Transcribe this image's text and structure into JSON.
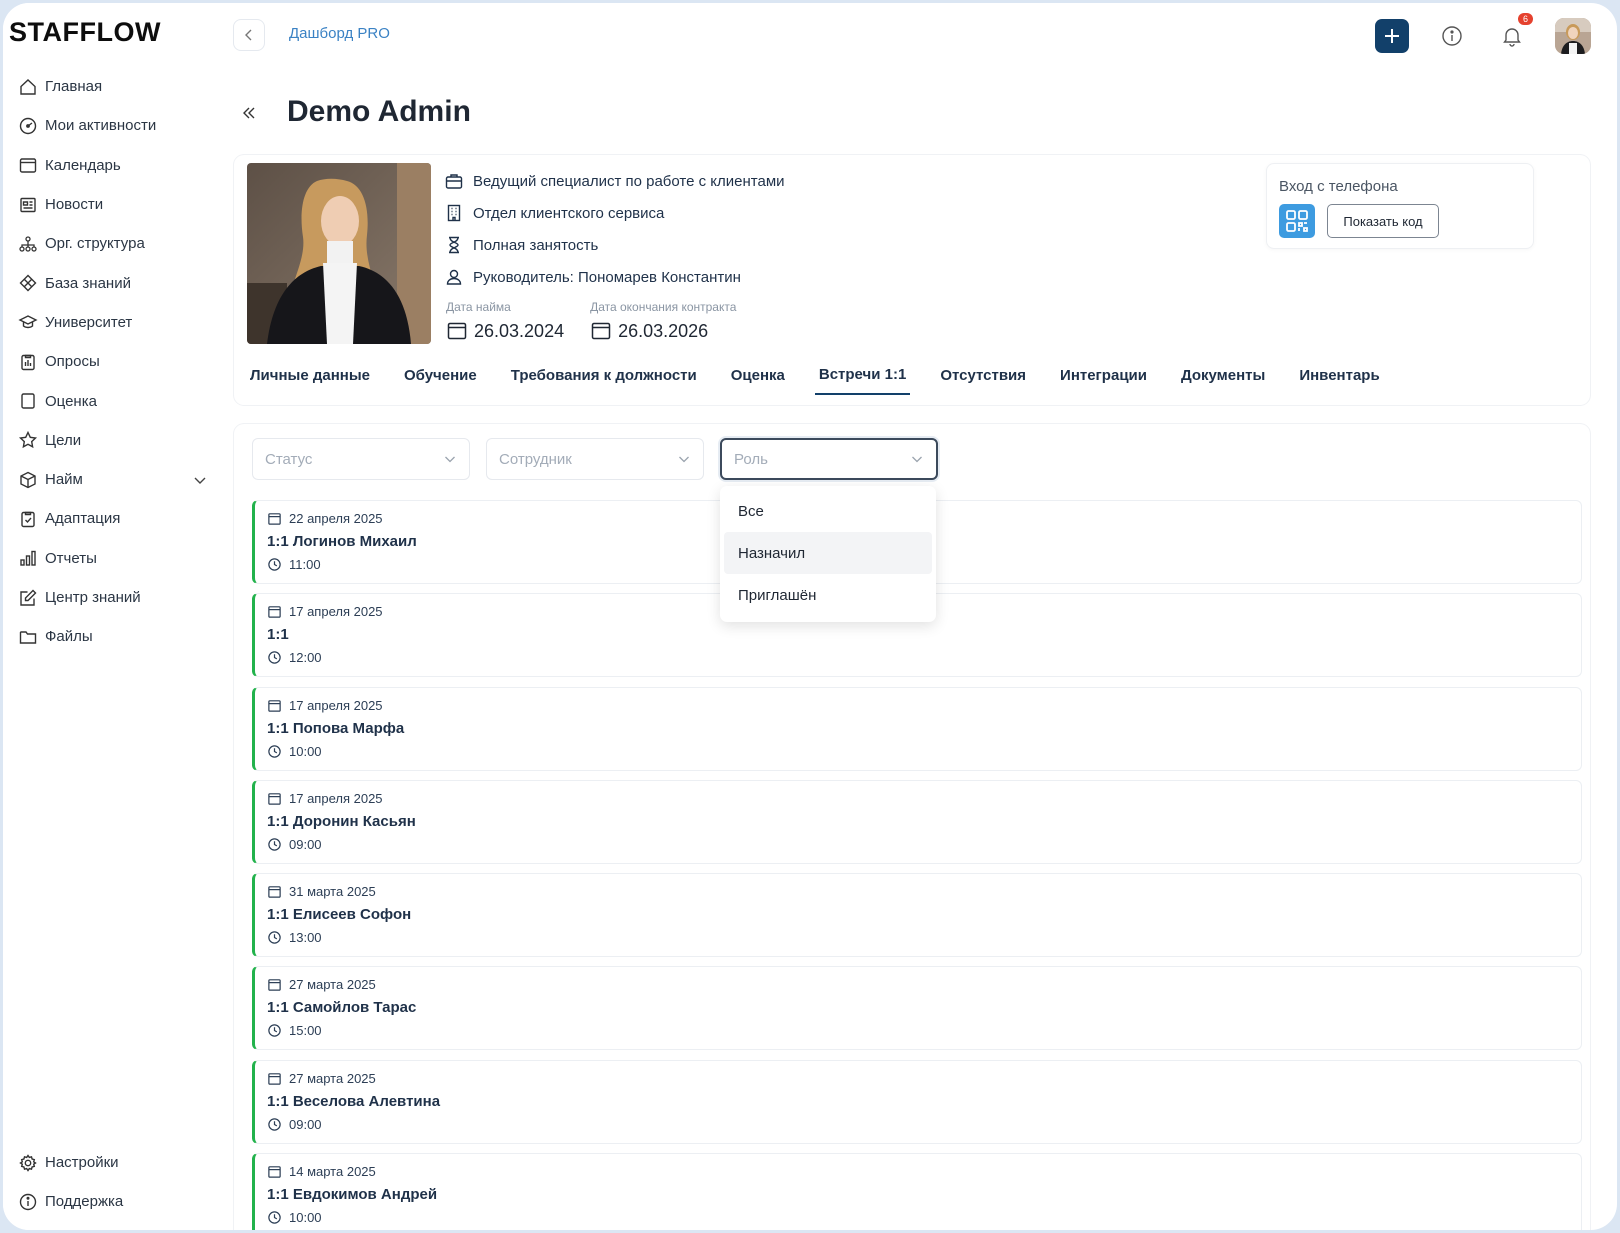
{
  "app": {
    "logo": "STAFFLOW"
  },
  "sidebar": {
    "items": [
      {
        "label": "Главная",
        "icon": "home-icon"
      },
      {
        "label": "Мои активности",
        "icon": "gauge-icon"
      },
      {
        "label": "Календарь",
        "icon": "calendar-icon"
      },
      {
        "label": "Новости",
        "icon": "newspaper-icon"
      },
      {
        "label": "Орг. структура",
        "icon": "org-chart-icon"
      },
      {
        "label": "База знаний",
        "icon": "diamond-icon"
      },
      {
        "label": "Университет",
        "icon": "graduation-cap-icon"
      },
      {
        "label": "Опросы",
        "icon": "clipboard-icon"
      },
      {
        "label": "Оценка",
        "icon": "square-icon"
      },
      {
        "label": "Цели",
        "icon": "star-icon"
      },
      {
        "label": "Найм",
        "icon": "cube-icon"
      },
      {
        "label": "Адаптация",
        "icon": "clipboard-check-icon"
      },
      {
        "label": "Отчеты",
        "icon": "bar-chart-icon"
      },
      {
        "label": "Центр знаний",
        "icon": "edit-icon"
      },
      {
        "label": "Файлы",
        "icon": "folder-icon"
      }
    ],
    "bottom": [
      {
        "label": "Настройки",
        "icon": "gear-icon"
      },
      {
        "label": "Поддержка",
        "icon": "info-icon"
      }
    ]
  },
  "topbar": {
    "breadcrumb": "Дашборд PRO",
    "notification_count": "6"
  },
  "page": {
    "title": "Demo Admin"
  },
  "profile": {
    "position": "Ведущий специалист по работе с клиентами",
    "department": "Отдел клиентского сервиса",
    "employment": "Полная занятость",
    "manager": "Руководитель: Пономарев Константин",
    "hire_date_label": "Дата найма",
    "hire_date": "26.03.2024",
    "contract_end_label": "Дата окончания контракта",
    "contract_end": "26.03.2026",
    "phone_login_label": "Вход с телефона",
    "show_code_label": "Показать код"
  },
  "tabs": [
    {
      "label": "Личные данные",
      "active": false
    },
    {
      "label": "Обучение",
      "active": false
    },
    {
      "label": "Требования к должности",
      "active": false
    },
    {
      "label": "Оценка",
      "active": false
    },
    {
      "label": "Встречи 1:1",
      "active": true
    },
    {
      "label": "Отсутствия",
      "active": false
    },
    {
      "label": "Интеграции",
      "active": false
    },
    {
      "label": "Документы",
      "active": false
    },
    {
      "label": "Инвентарь",
      "active": false
    }
  ],
  "filters": {
    "status_placeholder": "Статус",
    "employee_placeholder": "Сотрудник",
    "role_placeholder": "Роль",
    "role_options": [
      "Все",
      "Назначил",
      "Приглашён"
    ]
  },
  "meetings": [
    {
      "date": "22 апреля 2025",
      "title": "1:1 Логинов Михаил",
      "time": "11:00"
    },
    {
      "date": "17 апреля 2025",
      "title": "1:1",
      "time": "12:00"
    },
    {
      "date": "17 апреля 2025",
      "title": "1:1 Попова Марфа",
      "time": "10:00"
    },
    {
      "date": "17 апреля 2025",
      "title": "1:1 Доронин Касьян",
      "time": "09:00"
    },
    {
      "date": "31 марта 2025",
      "title": "1:1 Елисеев Софон",
      "time": "13:00"
    },
    {
      "date": "27 марта 2025",
      "title": "1:1 Самойлов Тарас",
      "time": "15:00"
    },
    {
      "date": "27 марта 2025",
      "title": "1:1 Веселова Алевтина",
      "time": "09:00"
    },
    {
      "date": "14 марта 2025",
      "title": "1:1 Евдокимов Андрей",
      "time": "10:00"
    }
  ],
  "colors": {
    "accent": "#12406a",
    "link": "#3b82c4",
    "meeting_marker": "#22b24c",
    "qr": "#3d9be0",
    "badge": "#e5412e"
  }
}
